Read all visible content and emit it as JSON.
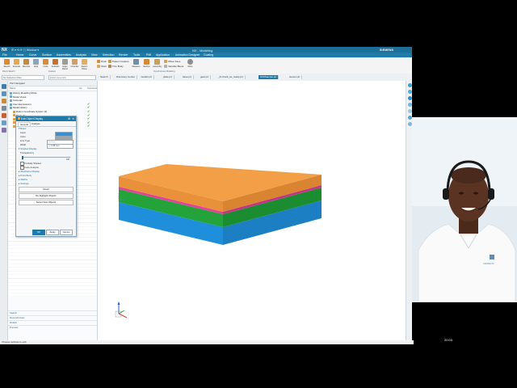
{
  "app": {
    "logo": "NX",
    "window_title": "NX - Modeling",
    "brand": "SIEMENS",
    "quick_access": "☰  ▾  ⟲  ⟳  ▢  Window ▾"
  },
  "menu": [
    "File",
    "Home",
    "Curve",
    "Surface",
    "Assemblies",
    "Analysis",
    "View",
    "Selection",
    "Render",
    "Tools",
    "PMI",
    "Application",
    "Animation Designer",
    "Coating"
  ],
  "ribbon": {
    "buttons": [
      {
        "label": "Sketch",
        "color": "#e08a2e"
      },
      {
        "label": "Extrude",
        "color": "#e5a84a"
      },
      {
        "label": "Revolve",
        "color": "#c58a3c"
      },
      {
        "label": "Hole",
        "color": "#8ba6b8"
      },
      {
        "label": "Unite",
        "color": "#d98c3a"
      },
      {
        "label": "Subtract",
        "color": "#c86f2a"
      },
      {
        "label": "Edge Blend",
        "color": "#9c9c9c"
      },
      {
        "label": "Chamfer",
        "color": "#cfa060"
      },
      {
        "label": "Datum Plane",
        "color": "#e3b060"
      }
    ],
    "small_tools": [
      "Draft",
      "Pattern Feature",
      "Shell",
      "Trim Body",
      "Offset Face",
      "Variable Blend"
    ],
    "right_buttons": [
      {
        "label": "Measure",
        "color": "#6e8fa8"
      },
      {
        "label": "Section",
        "color": "#d98a2e"
      },
      {
        "label": "Assembly",
        "color": "#c9a25a"
      },
      {
        "label": "More",
        "color": "#8f8f8f"
      }
    ],
    "group_labels": [
      "Direct Sketch",
      "Feature",
      "Synchronous Modeling"
    ]
  },
  "toolbar": {
    "filter_label": "No Selection Filter",
    "assembly_filter": "Entire Assembly",
    "tabs": [
      "Search",
      "Discovery Center",
      "model1.prt",
      "plate.prt",
      "base.prt",
      "gear.prt",
      "_fix block_as_ready.prt",
      "NX9Sample.prt",
      "stone1.prt"
    ],
    "active_tab": "NX9Sample.prt"
  },
  "navigator": {
    "title": "Part Navigator",
    "col_name": "Name",
    "col_up": "Up",
    "col_comment": "Comment",
    "tree": [
      "History Modeling Mode",
      "Model Views",
      "Cameras",
      "User Expressions",
      "Model History",
      "Datum Coordinate System (0)",
      "Block (1)",
      "Block (2)",
      "Block (3)",
      "Block (4)"
    ],
    "footer": [
      "Search",
      "Dependencies",
      "Details",
      "Preview"
    ]
  },
  "dialog": {
    "title": "Edit Object Display",
    "tabs": [
      "General",
      "Analysis"
    ],
    "sections": {
      "basic": "Basic",
      "layer_label": "Layer",
      "layer_value": "1",
      "color_label": "Color",
      "linetype_label": "Line Type",
      "width_label": "Width",
      "width_value": "— 0.35 mm",
      "shaded": "Shaded Display",
      "transparency": "Transparency",
      "transparency_value": "0",
      "transparency_max": "100",
      "partially_shaded": "Partially Shaded",
      "face_analysis": "Face Analysis",
      "wireframe": "Wireframe Display",
      "point_body": "Point Body",
      "widths": "Widths",
      "settings": "Settings"
    },
    "buttons": {
      "inherit": "Inherit",
      "rehighlight": "Re-highlight Objects",
      "select_new": "Select New Objects",
      "ok": "OK",
      "apply": "Apply",
      "cancel": "Cancel"
    }
  },
  "model": {
    "layers": [
      {
        "name": "top",
        "color": "#f29f47"
      },
      {
        "name": "magenta",
        "color": "#e0419a"
      },
      {
        "name": "green",
        "color": "#23a33a"
      },
      {
        "name": "blue",
        "color": "#1f8fdc"
      }
    ]
  },
  "status": {
    "text": "Choose settings to edit"
  },
  "clock": "20:03",
  "presenter": {
    "shirt_logo": "SIEMENS"
  }
}
